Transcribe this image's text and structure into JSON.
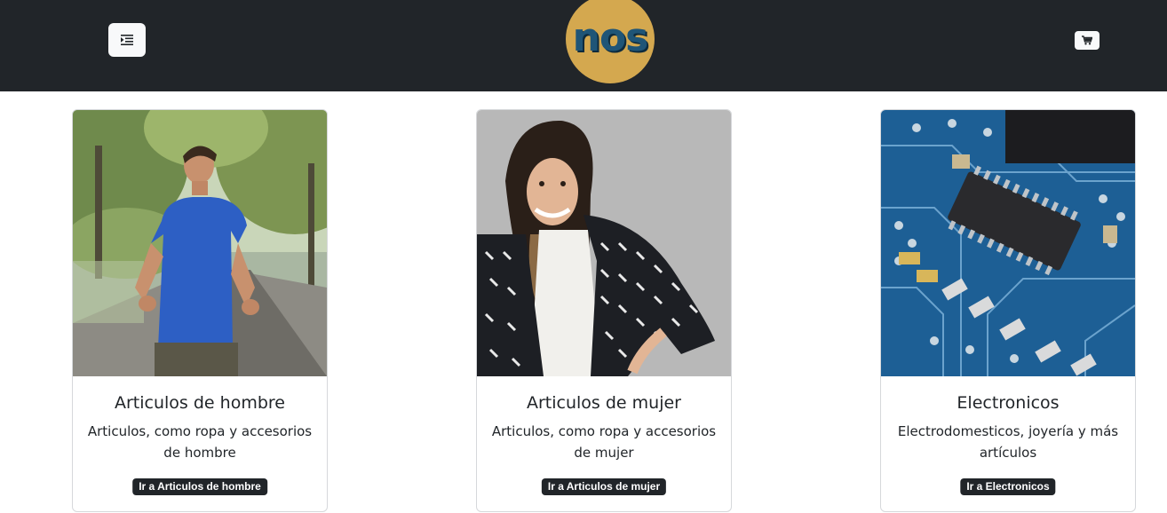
{
  "header": {
    "logo_text": "nos",
    "menu_icon": "menu-indent-icon",
    "cart_icon": "cart-icon"
  },
  "colors": {
    "navbar": "#212529",
    "logo_bg": "#d4a84f",
    "logo_text": "#1f5577",
    "button_dark": "#212529"
  },
  "cards": [
    {
      "title": "Articulos de hombre",
      "text": "Articulos, como ropa y accesorios de hombre",
      "button": "Ir a Articulos de hombre"
    },
    {
      "title": "Articulos de mujer",
      "text": "Articulos, como ropa y accesorios de mujer",
      "button": "Ir a Articulos de mujer"
    },
    {
      "title": "Electronicos",
      "text": "Electrodomesticos, joyería y más artículos",
      "button": "Ir a Electronicos"
    }
  ]
}
